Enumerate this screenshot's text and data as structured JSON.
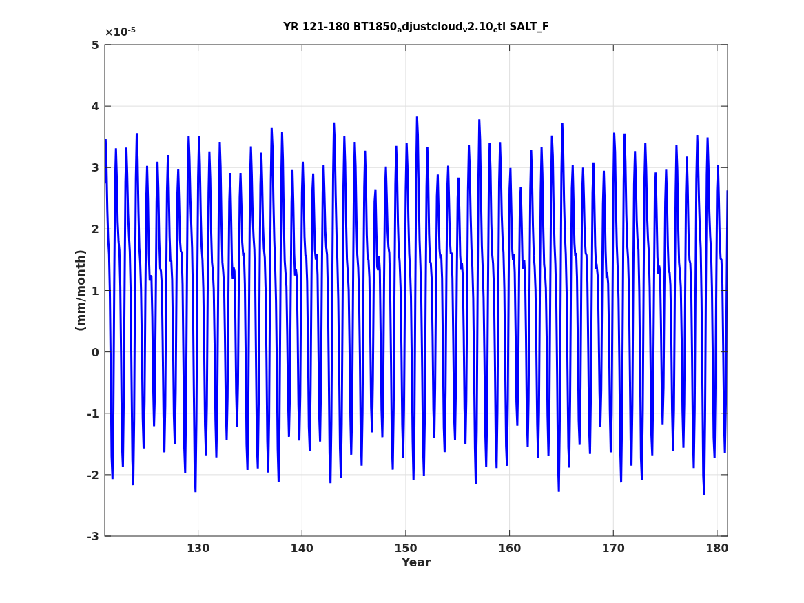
{
  "figure": {
    "title": "YR 121-180 BT1850$_{a}$djustcloud$_{v}$2.10$_{c}$tl SALT_F",
    "exponent_label": "×10$^{-5}$",
    "ylabel": "(mm/month)",
    "xlabel": "Year",
    "yticks": [
      "5",
      "4",
      "3",
      "2",
      "1",
      "0",
      "-1",
      "-2",
      "-3"
    ],
    "xticks": [
      "130",
      "140",
      "150",
      "160",
      "170",
      "180"
    ]
  }
}
